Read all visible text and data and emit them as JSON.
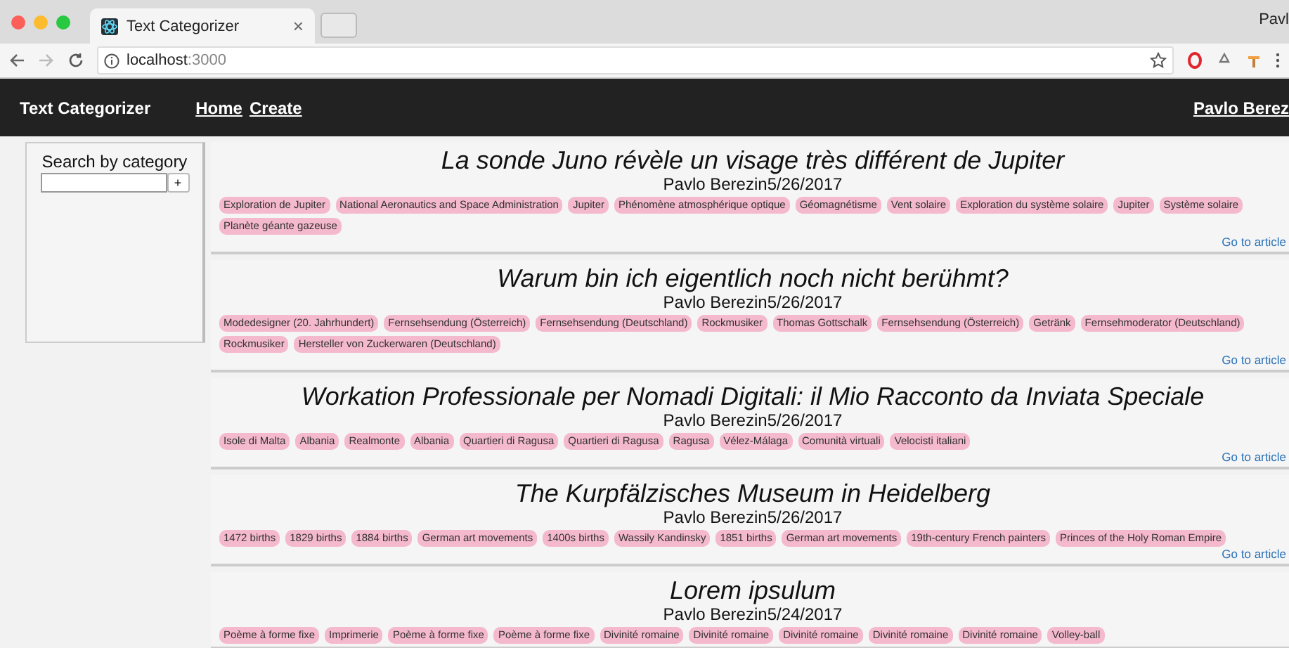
{
  "browser": {
    "tab_title": "Text Categorizer",
    "tab_close": "×",
    "profile": "Pavl",
    "url_host": "localhost",
    "url_port": ":3000"
  },
  "navbar": {
    "brand": "Text Categorizer",
    "links": [
      "Home",
      "Create"
    ],
    "user": "Pavlo Berez"
  },
  "sidebar": {
    "title": "Search by category",
    "add_button": "+"
  },
  "articles": [
    {
      "title": "La sonde Juno révèle un visage très différent de Jupiter",
      "byline": "Pavlo Berezin5/26/2017",
      "tags": [
        "Exploration de Jupiter",
        "National Aeronautics and Space Administration",
        "Jupiter",
        "Phénomène atmosphérique optique",
        "Géomagnétisme",
        "Vent solaire",
        "Exploration du système solaire",
        "Jupiter",
        "Système solaire",
        "Planète géante gazeuse"
      ],
      "link": "Go to article"
    },
    {
      "title": "Warum bin ich eigentlich noch nicht berühmt?",
      "byline": "Pavlo Berezin5/26/2017",
      "tags": [
        "Modedesigner (20. Jahrhundert)",
        "Fernsehsendung (Österreich)",
        "Fernsehsendung (Deutschland)",
        "Rockmusiker",
        "Thomas Gottschalk",
        "Fernsehsendung (Österreich)",
        "Getränk",
        "Fernsehmoderator (Deutschland)",
        "Rockmusiker",
        "Hersteller von Zuckerwaren (Deutschland)"
      ],
      "link": "Go to article"
    },
    {
      "title": "Workation Professionale per Nomadi Digitali: il Mio Racconto da Inviata Speciale",
      "byline": "Pavlo Berezin5/26/2017",
      "tags": [
        "Isole di Malta",
        "Albania",
        "Realmonte",
        "Albania",
        "Quartieri di Ragusa",
        "Quartieri di Ragusa",
        "Ragusa",
        "Vélez-Málaga",
        "Comunità virtuali",
        "Velocisti italiani"
      ],
      "link": "Go to article"
    },
    {
      "title": "The Kurpfälzisches Museum in Heidelberg",
      "byline": "Pavlo Berezin5/26/2017",
      "tags": [
        "1472 births",
        "1829 births",
        "1884 births",
        "German art movements",
        "1400s births",
        "Wassily Kandinsky",
        "1851 births",
        "German art movements",
        "19th-century French painters",
        "Princes of the Holy Roman Empire"
      ],
      "link": "Go to article"
    },
    {
      "title": "Lorem ipsulum",
      "byline": "Pavlo Berezin5/24/2017",
      "tags": [
        "Poème à forme fixe",
        "Imprimerie",
        "Poème à forme fixe",
        "Poème à forme fixe",
        "Divinité romaine",
        "Divinité romaine",
        "Divinité romaine",
        "Divinité romaine",
        "Divinité romaine",
        "Volley-ball"
      ]
    }
  ]
}
